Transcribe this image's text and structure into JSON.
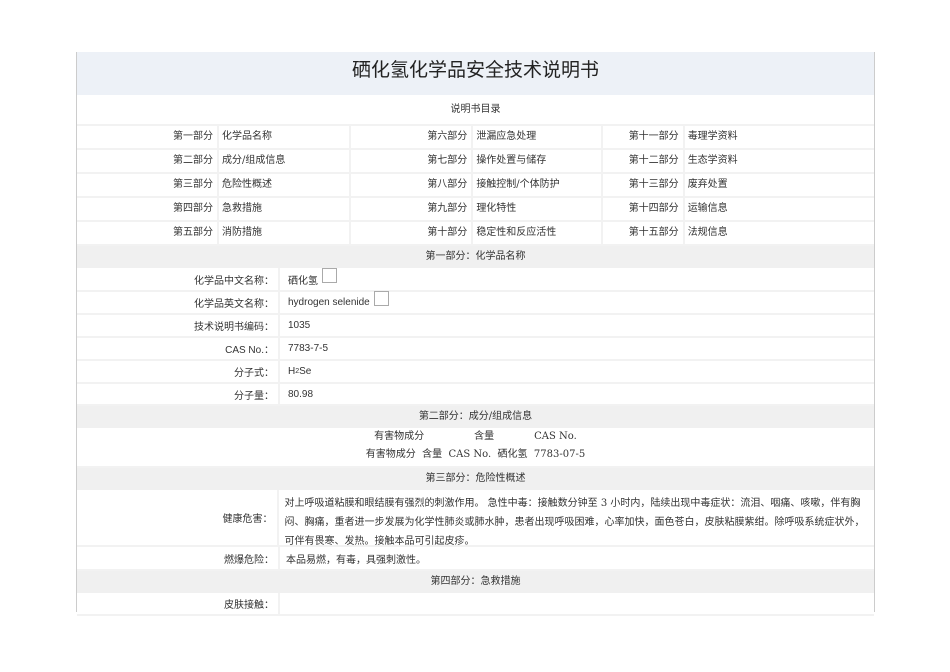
{
  "title": "硒化氢化学品安全技术说明书",
  "toc_heading": "说明书目录",
  "toc": [
    [
      {
        "p": "第一部分",
        "n": "化学品名称"
      },
      {
        "p": "第六部分",
        "n": "泄漏应急处理"
      },
      {
        "p": "第十一部分",
        "n": "毒理学资料"
      }
    ],
    [
      {
        "p": "第二部分",
        "n": "成分/组成信息"
      },
      {
        "p": "第七部分",
        "n": "操作处置与储存"
      },
      {
        "p": "第十二部分",
        "n": "生态学资料"
      }
    ],
    [
      {
        "p": "第三部分",
        "n": "危险性概述"
      },
      {
        "p": "第八部分",
        "n": "接触控制/个体防护"
      },
      {
        "p": "第十三部分",
        "n": "废弃处置"
      }
    ],
    [
      {
        "p": "第四部分",
        "n": "急救措施"
      },
      {
        "p": "第九部分",
        "n": "理化特性"
      },
      {
        "p": "第十四部分",
        "n": "运输信息"
      }
    ],
    [
      {
        "p": "第五部分",
        "n": "消防措施"
      },
      {
        "p": "第十部分",
        "n": "稳定性和反应活性"
      },
      {
        "p": "第十五部分",
        "n": "法规信息"
      }
    ]
  ],
  "s1": {
    "heading": "第一部分：化学品名称",
    "rows": [
      {
        "l": "化学品中文名称：",
        "v": "硒化氢"
      },
      {
        "l": "化学品英文名称：",
        "v": "hydrogen selenide"
      },
      {
        "l": "技术说明书编码：",
        "v": "1035"
      },
      {
        "l": "CAS No.：",
        "v": "7783-7-5"
      },
      {
        "l": "分子式：",
        "v1": "H",
        "sub": "2",
        "v2": "Se"
      },
      {
        "l": "分子量：",
        "v": "80.98"
      }
    ]
  },
  "s2": {
    "heading": "第二部分：成分/组成信息",
    "line1": "有害物成分　　　　　含量　　　　CAS No.",
    "line2": "有害物成分  含量  CAS No.  硒化氢  7783-07-5"
  },
  "s3": {
    "heading": "第三部分：危险性概述",
    "health_label": "健康危害：",
    "health": "对上呼吸道粘膜和眼结膜有强烈的刺激作用。 急性中毒：接触数分钟至 3 小时内，陆续出现中毒症状：流泪、咽痛、咳嗽，伴有胸闷、胸痛，重者进一步发展为化学性肺炎或肺水肿，患者出现呼吸困难，心率加快，面色苍白，皮肤粘膜紫绀。除呼吸系统症状外，可伴有畏寒、发热。接触本品可引起皮疹。",
    "fire_label": "燃爆危险：",
    "fire": "本品易燃，有毒，具强刺激性。"
  },
  "s4": {
    "heading": "第四部分：急救措施",
    "skin_label": "皮肤接触："
  }
}
